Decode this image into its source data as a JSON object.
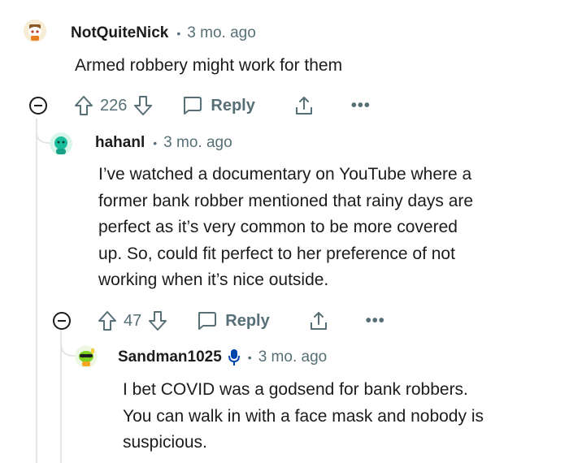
{
  "comments": [
    {
      "username": "NotQuiteNick",
      "time": "3 mo. ago",
      "body_lines": [
        "Armed robbery might work for them"
      ],
      "votes": "226",
      "reply_label": "Reply",
      "more_label": "•••",
      "avatar_icon": "snoo-avatar-icon"
    },
    {
      "username": "hahanl",
      "time": "3 mo. ago",
      "body_lines": [
        "I’ve watched a documentary on YouTube where a",
        "former bank robber mentioned that rainy days are",
        "perfect as it’s very common to be more covered",
        "up. So, could fit perfect to her preference of not",
        "working when it’s nice outside."
      ],
      "votes": "47",
      "reply_label": "Reply",
      "more_label": "•••",
      "avatar_icon": "snoo-avatar-icon"
    },
    {
      "username": "Sandman1025",
      "time": "3 mo. ago",
      "body_lines": [
        "I bet COVID was a godsend for bank robbers.",
        "You can walk in with a face mask and nobody is",
        "suspicious."
      ],
      "avatar_icon": "snoo-avatar-icon",
      "badge_icon": "microphone-icon"
    }
  ],
  "separator": "•",
  "colors": {
    "text": "#1c1c1c",
    "meta": "#576f76",
    "thread_line": "#e3e6e8",
    "mic_blue": "#0045ac"
  }
}
